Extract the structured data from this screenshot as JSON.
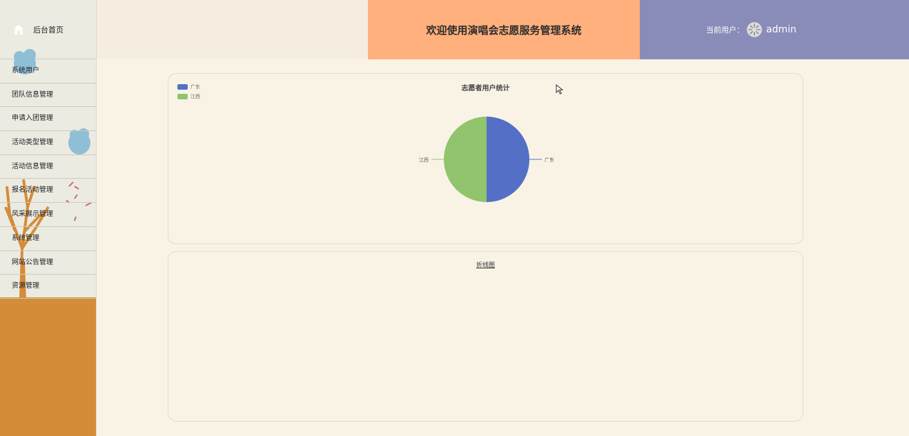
{
  "sidebar": {
    "home_label": "后台首页",
    "items": [
      {
        "label": "系统用户"
      },
      {
        "label": "团队信息管理"
      },
      {
        "label": "申请入团管理"
      },
      {
        "label": "活动类型管理"
      },
      {
        "label": "活动信息管理"
      },
      {
        "label": "报名活动管理"
      },
      {
        "label": "风采展示管理"
      },
      {
        "label": "系统管理"
      },
      {
        "label": "网站公告管理"
      },
      {
        "label": "资源管理"
      }
    ]
  },
  "header": {
    "title": "欢迎使用演唱会志愿服务管理系统",
    "user_label": "当前用户：",
    "username": "admin"
  },
  "colors": {
    "sidebar_bg": "#ecebe2",
    "sidebar_tree": "#d48c38",
    "title_bg": "#ffb07c",
    "user_bg": "#898bb8",
    "page_bg": "#f9f3e6",
    "series_guangdong": "#5470c6",
    "series_jiangxi": "#91c46c"
  },
  "chart_data": [
    {
      "type": "pie",
      "title": "志愿者用户统计",
      "legend_position": "top-left",
      "categories": [
        "广东",
        "江西"
      ],
      "values": [
        1,
        1
      ],
      "colors": [
        "#5470c6",
        "#91c46c"
      ]
    },
    {
      "type": "line",
      "title": "折线图",
      "series": []
    }
  ]
}
